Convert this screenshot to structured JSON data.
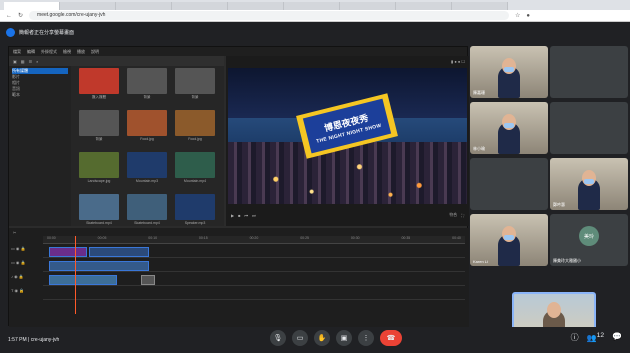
{
  "browser": {
    "tabs": [
      "",
      "",
      "",
      "",
      "",
      "",
      "",
      "",
      ""
    ],
    "url": "meet.google.com/cre-ujany-jvh"
  },
  "presenter": {
    "label": "簡報者正在分享螢幕畫面"
  },
  "editor": {
    "menu": [
      "檔案",
      "編輯",
      "外掛程式",
      "檢視",
      "播放",
      "說明"
    ],
    "media_sidebar": [
      "所有媒體",
      "影片",
      "相片",
      "音訊",
      "範本"
    ],
    "media_items": [
      {
        "label": "匯入媒體",
        "color": "#c0392b"
      },
      {
        "label": "背景",
        "color": "#555555"
      },
      {
        "label": "背景",
        "color": "#555555"
      },
      {
        "label": "背景",
        "color": "#555555"
      },
      {
        "label": "Food.jpg",
        "color": "#a0522d"
      },
      {
        "label": "Food.jpg",
        "color": "#8b5a2b"
      },
      {
        "label": "Landscape.jpg",
        "color": "#556b2f"
      },
      {
        "label": "Mountain.mp3",
        "color": "#1f3b6b"
      },
      {
        "label": "Mountain.mp4",
        "color": "#2e5d4b"
      },
      {
        "label": "Skateboard.mp4",
        "color": "#4a6b8a"
      },
      {
        "label": "Skateboard.mp4",
        "color": "#3f5f7a"
      },
      {
        "label": "Speaker.mp3",
        "color": "#1f3b6b"
      }
    ],
    "preview_title": "",
    "preview_text_cn": "博恩夜夜秀",
    "preview_text_en": "THE NIGHT NIGHT SHOW",
    "preview_fit": "符合",
    "timeline_ruler": [
      "00:00",
      "00:05",
      "00:10",
      "00:15",
      "00:20",
      "00:25",
      "00:30",
      "00:35",
      "00:40"
    ]
  },
  "participants": [
    {
      "name": "陳嘉珊",
      "type": "cam"
    },
    {
      "name": "",
      "type": "empty"
    },
    {
      "name": "林小瑜",
      "type": "cam"
    },
    {
      "name": "",
      "type": "empty"
    },
    {
      "name": "",
      "type": "empty"
    },
    {
      "name": "鄭吟惠",
      "type": "cam"
    },
    {
      "name": "Karen Li",
      "type": "cam"
    },
    {
      "name": "陳美玲大雅國小",
      "type": "avatar",
      "initials": "美玲"
    }
  ],
  "bottom": {
    "time": "1:57 PM",
    "meeting_code": "cre-ujany-jvh"
  },
  "controls": [
    "mic-icon",
    "camera-icon",
    "hand-icon",
    "present-icon",
    "more-icon",
    "hangup-icon"
  ],
  "right_controls": [
    "info-icon",
    "people-icon",
    "chat-icon"
  ],
  "people_count": "12"
}
